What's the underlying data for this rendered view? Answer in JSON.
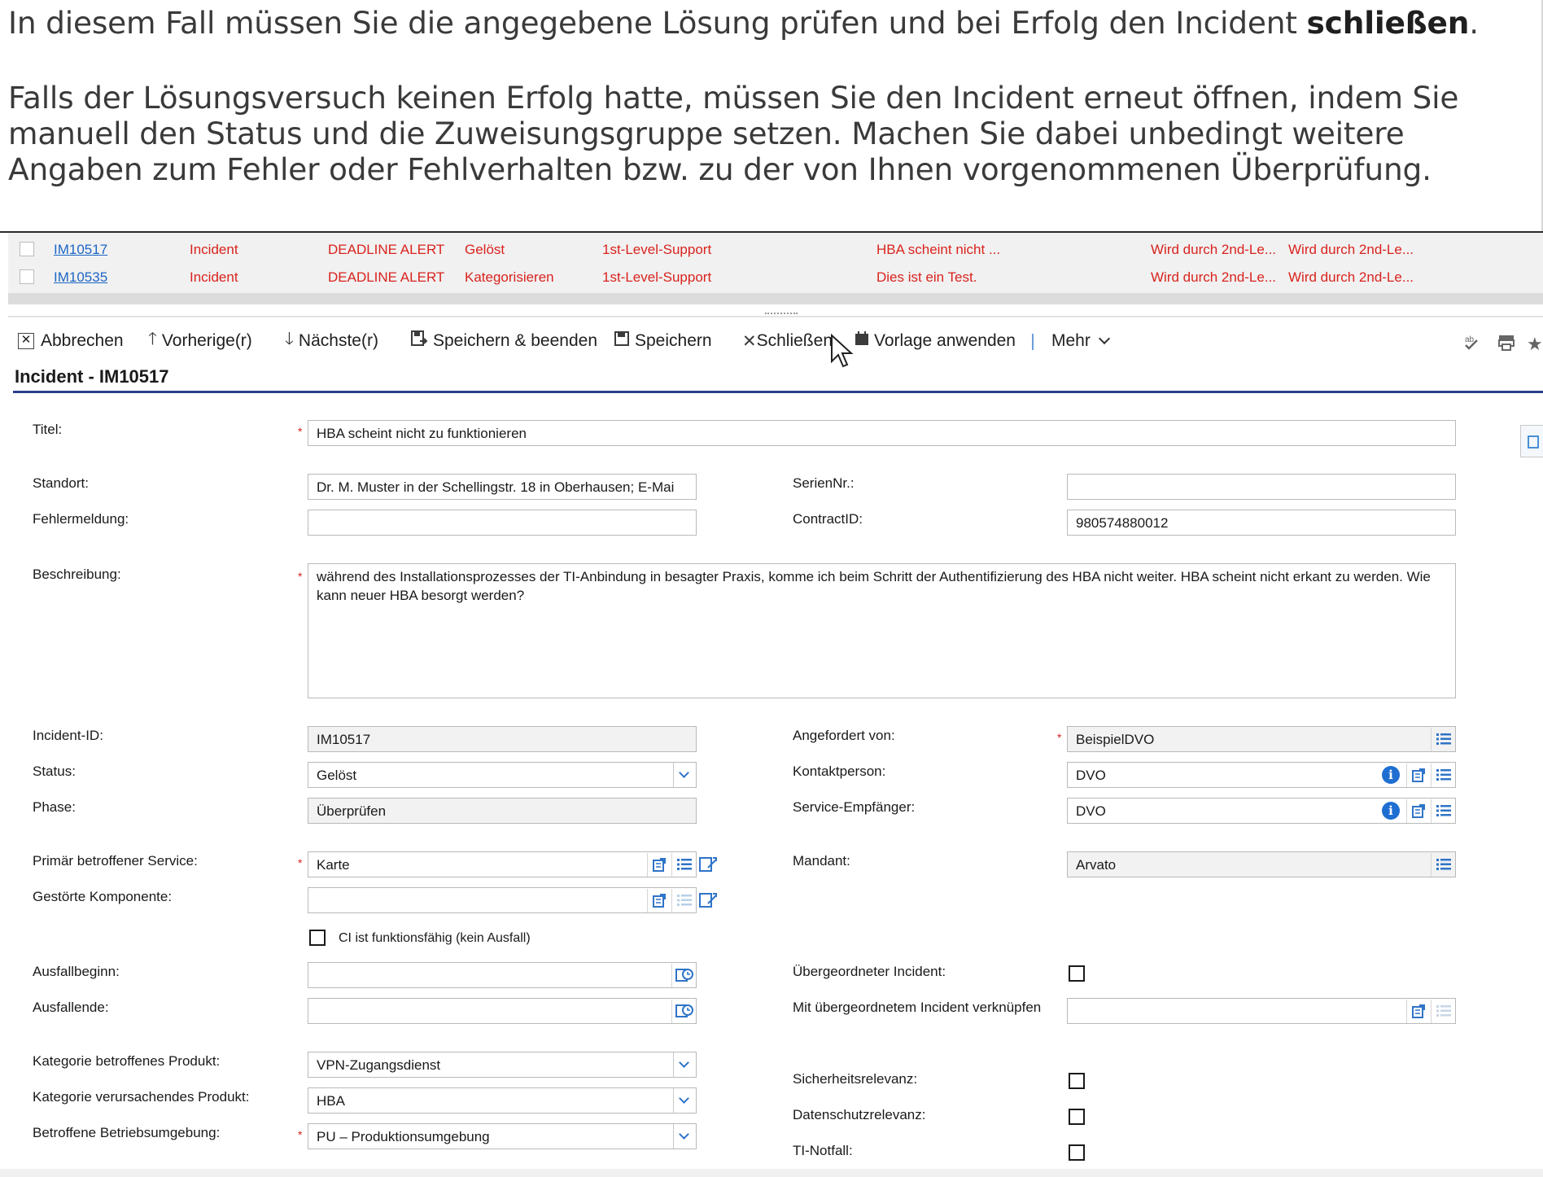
{
  "intro": {
    "line1_pre": "In diesem Fall müssen Sie die angegebene Lösung prüfen und bei Erfolg den Incident ",
    "line1_bold": "schließen",
    "line1_post": ".",
    "line2": "Falls der Lösungsversuch keinen Erfolg hatte, müssen Sie den Incident erneut öffnen, indem Sie",
    "line3": "manuell den Status und die Zuweisungsgruppe setzen. Machen Sie dabei unbedingt weitere",
    "line4": "Angaben zum Fehler oder Fehlverhalten bzw. zu der von Ihnen vorgenommenen Überprüfung."
  },
  "list": {
    "rows": [
      {
        "id": "IM10517",
        "type": "Incident",
        "alert": "DEADLINE ALERT",
        "status": "Gelöst",
        "group": "1st-Level-Support",
        "title": "HBA scheint nicht ...",
        "col7": "Wird durch 2nd-Le...",
        "col8": "Wird durch 2nd-Le..."
      },
      {
        "id": "IM10535",
        "type": "Incident",
        "alert": "DEADLINE ALERT",
        "status": "Kategorisieren",
        "group": "1st-Level-Support",
        "title": "Dies ist ein Test.",
        "col7": "Wird durch 2nd-Le...",
        "col8": "Wird durch 2nd-Le..."
      }
    ]
  },
  "toolbar": {
    "cancel": "Abbrechen",
    "prev": "Vorherige(r)",
    "next": "Nächste(r)",
    "save_close": "Speichern & beenden",
    "save": "Speichern",
    "close": "Schließen",
    "template": "Vorlage anwenden",
    "more": "Mehr"
  },
  "form": {
    "heading": "Incident - IM10517",
    "labels": {
      "titel": "Titel:",
      "standort": "Standort:",
      "seriennr": "SerienNr.:",
      "fehlermeldung": "Fehlermeldung:",
      "contractid": "ContractID:",
      "beschreibung": "Beschreibung:",
      "incident_id": "Incident-ID:",
      "angefordert": "Angefordert von:",
      "status": "Status:",
      "kontakt": "Kontaktperson:",
      "phase": "Phase:",
      "service_empf": "Service-Empfänger:",
      "primaer_service": "Primär betroffener Service:",
      "mandant": "Mandant:",
      "gestoerte_komp": "Gestörte Komponente:",
      "ci_checkbox": "CI ist funktionsfähig (kein Ausfall)",
      "ausfallbeginn": "Ausfallbeginn:",
      "uebergeordnet": "Übergeordneter Incident:",
      "ausfallende": "Ausfallende:",
      "verknuepfen": "Mit übergeordnetem Incident verknüpfen",
      "kat_produkt": "Kategorie betroffenes Produkt:",
      "kat_verursachend": "Kategorie verursachendes Produkt:",
      "betriebsumgebung": "Betroffene Betriebsumgebung:",
      "sicherheit": "Sicherheitsrelevanz:",
      "datenschutz": "Datenschutzrelevanz:",
      "ti_notfall": "TI-Notfall:"
    },
    "values": {
      "titel": "HBA scheint nicht zu funktionieren",
      "standort": "Dr. M. Muster in der Schellingstr. 18 in Oberhausen; E-Mai",
      "seriennr": "",
      "fehlermeldung": "",
      "contractid": "980574880012",
      "beschreibung": "während des Installationsprozesses der TI-Anbindung in besagter Praxis, komme ich beim Schritt der Authentifizierung des HBA nicht weiter. HBA scheint nicht erkant zu werden. Wie kann neuer HBA besorgt werden?",
      "incident_id": "IM10517",
      "angefordert": "BeispielDVO",
      "status": "Gelöst",
      "kontakt": "DVO",
      "phase": "Überprüfen",
      "service_empf": "DVO",
      "primaer_service": "Karte",
      "mandant": "Arvato",
      "gestoerte_komp": "",
      "ausfallbeginn": "",
      "ausfallende": "",
      "verknuepfen": "",
      "kat_produkt": "VPN-Zugangsdienst",
      "kat_verursachend": "HBA",
      "betriebsumgebung": "PU – Produktionsumgebung"
    },
    "required_marker": "*"
  },
  "colors": {
    "alert_red": "#d9231e",
    "link_blue": "#1d66c4",
    "heading_line": "#2b3f8c",
    "icon_blue": "#2f74c8"
  }
}
